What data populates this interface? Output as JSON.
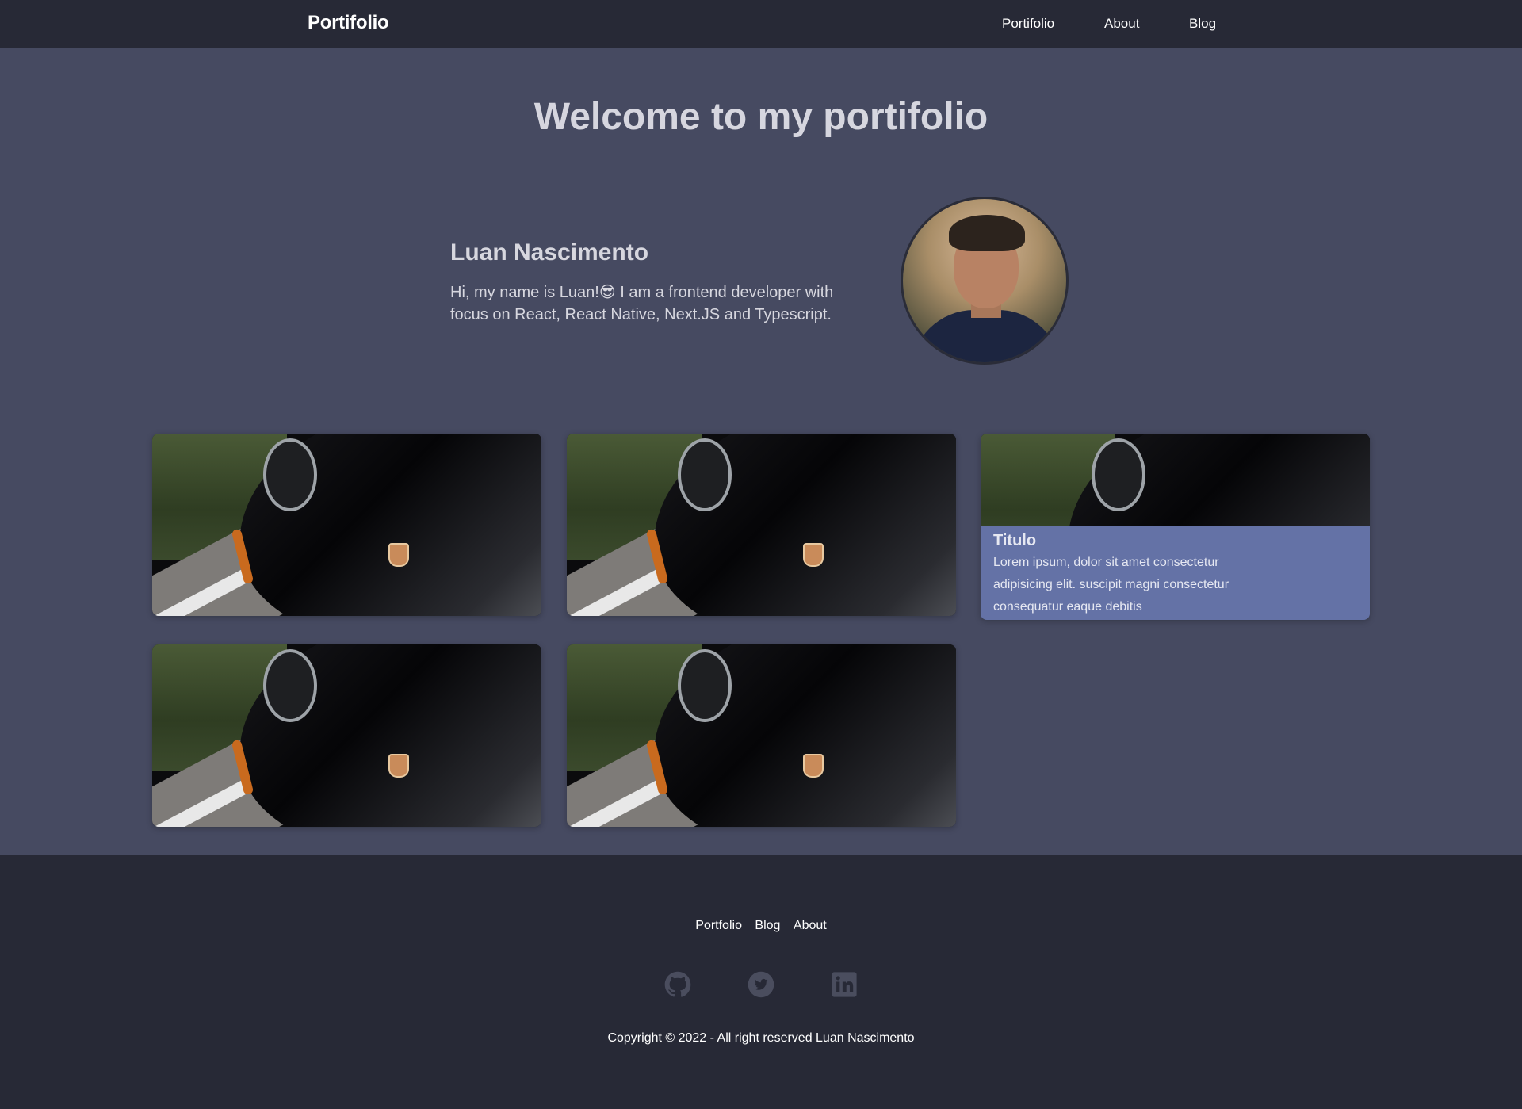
{
  "header": {
    "brand": "Portifolio",
    "nav": [
      {
        "label": "Portifolio"
      },
      {
        "label": "About"
      },
      {
        "label": "Blog"
      }
    ]
  },
  "hero": {
    "title": "Welcome to my portifolio",
    "name": "Luan Nascimento",
    "bio": "Hi, my name is Luan!😎 I am a frontend developer with focus on React, React Native, Next.JS and Typescript."
  },
  "projects": [
    {
      "image": "car-photo"
    },
    {
      "image": "car-photo"
    },
    {
      "image": "car-photo",
      "title": "Titulo",
      "description": "Lorem ipsum, dolor sit amet consectetur adipisicing elit. suscipit magni consectetur consequatur eaque debitis"
    },
    {
      "image": "car-photo"
    },
    {
      "image": "car-photo"
    }
  ],
  "footer": {
    "links": [
      {
        "label": "Portfolio"
      },
      {
        "label": "Blog"
      },
      {
        "label": "About"
      }
    ],
    "socials": [
      "github-icon",
      "twitter-icon",
      "linkedin-icon"
    ],
    "copyright": "Copyright © 2022 - All right reserved Luan Nascimento"
  },
  "colors": {
    "header_bg": "#272936",
    "page_bg": "#464a61",
    "card_caption_bg": "#6472a6",
    "social_icon": "#4a4d5e"
  }
}
